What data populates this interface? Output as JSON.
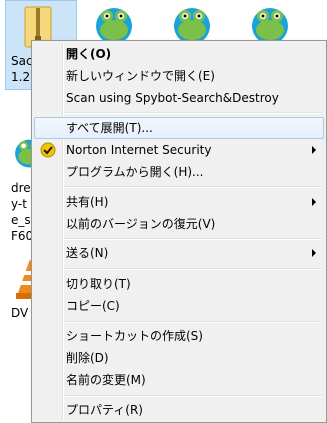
{
  "desktop": {
    "selected_file": {
      "label_lines": [
        "Sac",
        "1.2"
      ],
      "icon": "zip-folder-icon"
    },
    "partial_files": [
      {
        "label_lines": [
          "dre",
          "y-t",
          "e_s",
          "F60"
        ],
        "icon": "frog-icon"
      },
      {
        "label_lines": [
          "DV"
        ],
        "icon": "vlc-cone-icon"
      }
    ],
    "top_icons": [
      "frog-icon",
      "frog-icon",
      "frog-icon"
    ]
  },
  "context_menu": {
    "items": [
      {
        "label": "開く(O)",
        "bold": true
      },
      {
        "label": "新しいウィンドウで開く(E)"
      },
      {
        "label": "Scan using Spybot-Search&Destroy"
      },
      {
        "label": "すべて展開(T)...",
        "highlighted": true
      },
      {
        "label": "Norton Internet Security",
        "submenu": true,
        "icon": "norton-icon"
      },
      {
        "label": "プログラムから開く(H)..."
      },
      {
        "label": "共有(H)",
        "submenu": true
      },
      {
        "label": "以前のバージョンの復元(V)"
      },
      {
        "label": "送る(N)",
        "submenu": true
      },
      {
        "label": "切り取り(T)"
      },
      {
        "label": "コピー(C)"
      },
      {
        "label": "ショートカットの作成(S)"
      },
      {
        "label": "削除(D)"
      },
      {
        "label": "名前の変更(M)"
      },
      {
        "label": "プロパティ(R)"
      }
    ]
  },
  "colors": {
    "selection": "#cce4f7",
    "menu_bg": "#f0f0f0",
    "highlight_border": "#a8c8ec"
  }
}
